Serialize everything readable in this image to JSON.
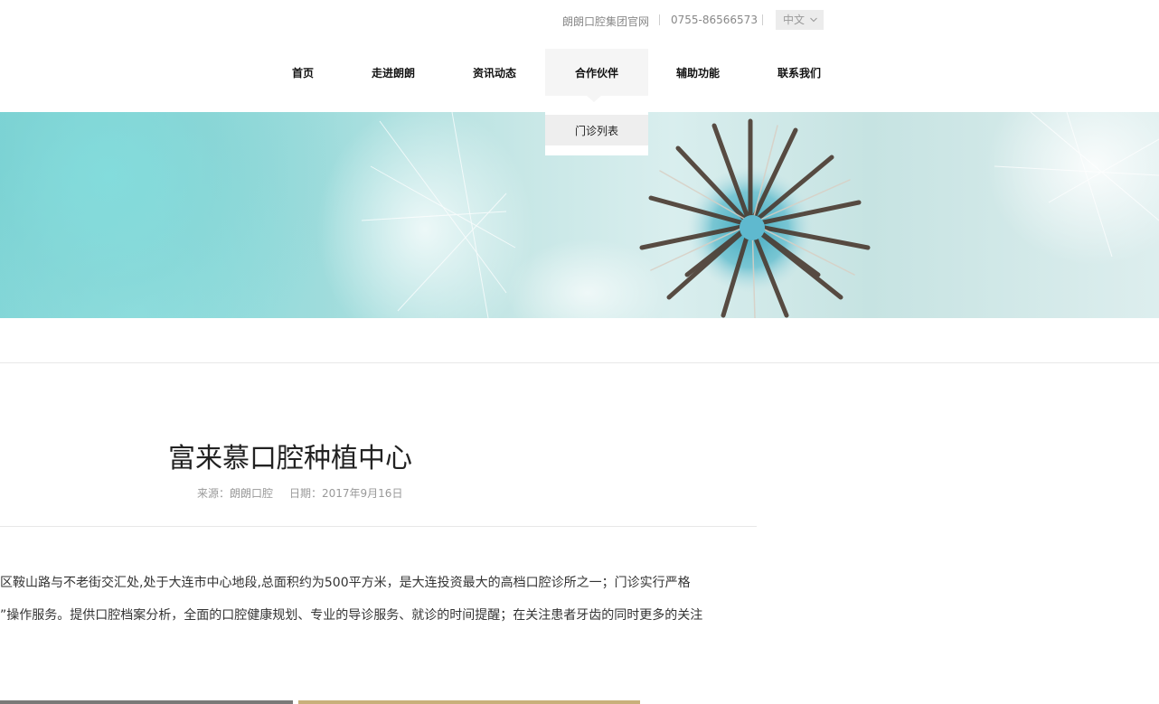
{
  "topbar": {
    "group_site": "朗朗口腔集团官网",
    "phone": "0755-86566573",
    "language": "中文"
  },
  "nav": {
    "items": [
      {
        "label": "首页"
      },
      {
        "label": "走进朗朗"
      },
      {
        "label": "资讯动态"
      },
      {
        "label": "合作伙伴"
      },
      {
        "label": "辅助功能"
      },
      {
        "label": "联系我们"
      }
    ],
    "active_index": 3,
    "dropdown": [
      {
        "label": "门诊列表"
      }
    ]
  },
  "article": {
    "title": "富来慕口腔种植中心",
    "source": "来源：朗朗口腔",
    "date": "日期：2017年9月16日",
    "paragraphs": [
      "岗区鞍山路与不老街交汇处,处于大连市中心地段,总面积约为500平方米，是大连投资最大的高档口腔诊所之一；门诊实行严格",
      "手”操作服务。提供口腔档案分析，全面的口腔健康规划、专业的导诊服务、就诊的时间提醒；在关注患者牙齿的同时更多的关注"
    ]
  },
  "colors": {
    "nav_active_bg": "#f5f5f5",
    "dropdown_item_bg": "#eeeeee",
    "banner_tone": "#8fd6d6"
  },
  "icons": {
    "language_dropdown": "chevron-down-icon"
  }
}
